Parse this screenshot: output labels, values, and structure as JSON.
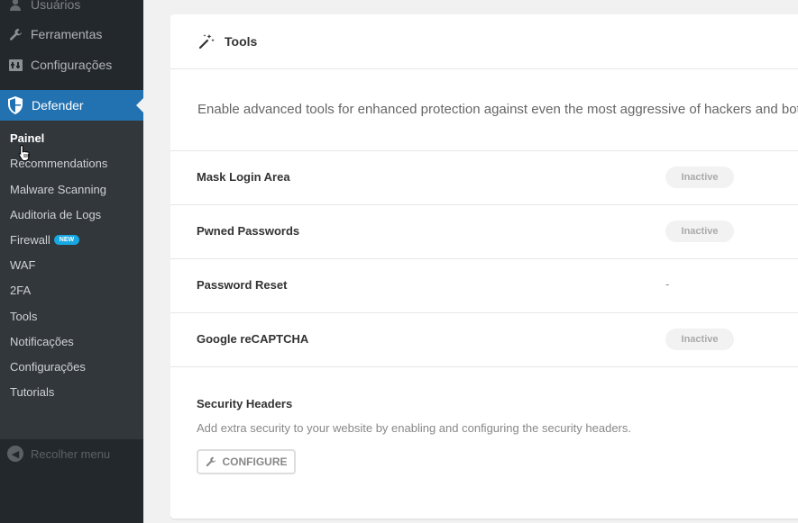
{
  "sidebar": {
    "top_items": [
      {
        "label": "Usuários",
        "icon": "user-icon"
      },
      {
        "label": "Ferramentas",
        "icon": "wrench-icon"
      },
      {
        "label": "Configurações",
        "icon": "settings-icon"
      }
    ],
    "active_menu": {
      "label": "Defender",
      "icon": "shield-icon"
    },
    "submenu": [
      {
        "label": "Painel",
        "current": true
      },
      {
        "label": "Recommendations"
      },
      {
        "label": "Malware Scanning"
      },
      {
        "label": "Auditoria de Logs"
      },
      {
        "label": "Firewall",
        "badge": "NEW"
      },
      {
        "label": "WAF"
      },
      {
        "label": "2FA"
      },
      {
        "label": "Tools"
      },
      {
        "label": "Notificações"
      },
      {
        "label": "Configurações"
      },
      {
        "label": "Tutorials"
      }
    ],
    "collapse_label": "Recolher menu"
  },
  "card": {
    "title": "Tools",
    "description": "Enable advanced tools for enhanced protection against even the most aggressive of hackers and bots.",
    "rows": [
      {
        "label": "Mask Login Area",
        "status": "Inactive"
      },
      {
        "label": "Pwned Passwords",
        "status": "Inactive"
      },
      {
        "label": "Password Reset",
        "status": "-"
      },
      {
        "label": "Google reCAPTCHA",
        "status": "Inactive"
      }
    ],
    "security_headers": {
      "title": "Security Headers",
      "description": "Add extra security to your website by enabling and configuring the security headers.",
      "button_label": "CONFIGURE"
    }
  },
  "colors": {
    "accent": "#2271b1",
    "sidebar_bg": "#23282d",
    "submenu_bg": "#32373c",
    "badge": "#17a8e3"
  }
}
